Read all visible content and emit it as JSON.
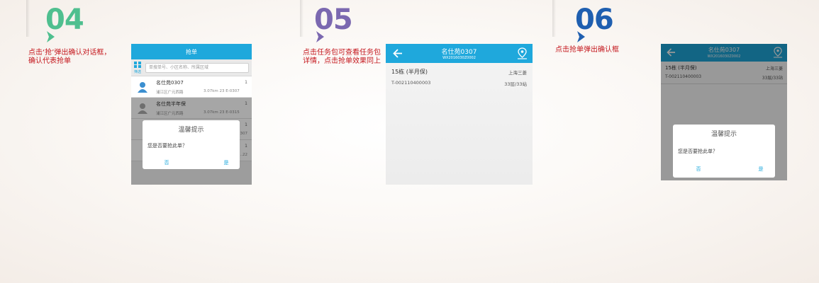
{
  "colors": {
    "accent": "#1fa8dc",
    "caption_red": "#c4161c",
    "step4_green": "#4fbf8f",
    "step5_purple": "#7b68b0",
    "step6_blue": "#1f5fb0"
  },
  "steps": [
    {
      "number": "04",
      "caption_lines": [
        "点击‘抢’弹出确认对话框，",
        "确认代表抢单"
      ]
    },
    {
      "number": "05",
      "caption_lines": [
        "点击任务包可查看任务包",
        "详情，点击抢单效果同上"
      ]
    },
    {
      "number": "06",
      "caption_lines": [
        "点击抢单弹出确认框"
      ]
    }
  ],
  "screen1": {
    "title": "抢单",
    "filter_label": "筛选",
    "search_placeholder": "单搜单号、小区名称、所属区域",
    "items": [
      {
        "name": "名仕苑0307",
        "sub": "浦江区广元西路",
        "distance": "3.07km 23 E-0307",
        "count": "1"
      },
      {
        "name": "名仕苑半年保",
        "sub": "浦江区广元西路",
        "distance": "3.07km 23 E-0315",
        "count": "1"
      },
      {
        "name": "",
        "sub": "",
        "distance": "…307",
        "count": "1"
      },
      {
        "name": "",
        "sub": "",
        "distance": "…22",
        "count": "1"
      }
    ],
    "dialog": {
      "title": "温馨提示",
      "message": "您是否要抢此单？",
      "no": "否",
      "yes": "是"
    }
  },
  "screen2": {
    "title": "名仕苑0307",
    "subtitle": "WX2016030Z0002",
    "row1_left": "15栋 (半月保)",
    "row1_right": "上海三菱",
    "row2_left": "T-002110400003",
    "row2_right": "33层/33站"
  },
  "screen3": {
    "title": "名仕苑0307",
    "subtitle": "WX2016030Z0002",
    "row1_left": "15栋 (半月保)",
    "row1_right": "上海三菱",
    "row2_left": "T-002110400003",
    "row2_right": "33层/33站",
    "dialog": {
      "title": "温馨提示",
      "message": "您是否要抢此单？",
      "no": "否",
      "yes": "是"
    }
  }
}
